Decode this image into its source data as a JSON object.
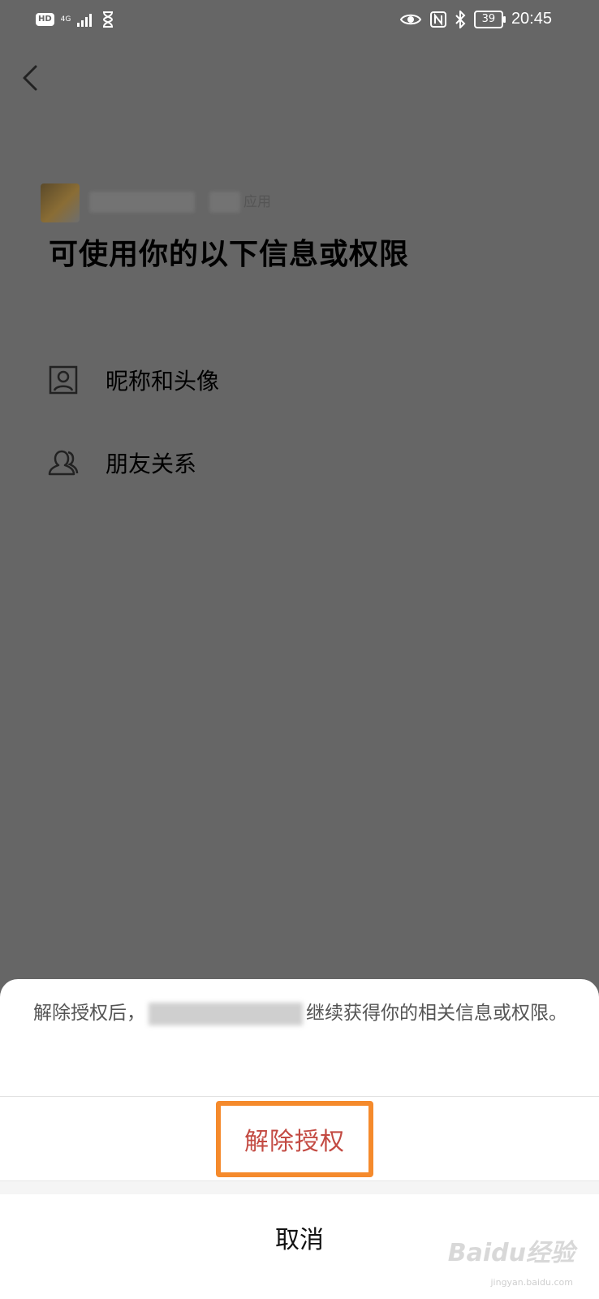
{
  "status_bar": {
    "hd": "HD",
    "network": "4G",
    "battery": "39",
    "time": "20:45"
  },
  "app": {
    "name_suffix": "应用"
  },
  "page": {
    "title": "可使用你的以下信息或权限"
  },
  "permissions": [
    {
      "label": "昵称和头像",
      "icon": "profile-card-icon"
    },
    {
      "label": "朋友关系",
      "icon": "friends-icon"
    }
  ],
  "sheet": {
    "notice_start": "解除授权后，",
    "notice_end": "继续获得你的相关信息或权限。",
    "revoke_label": "解除授权",
    "cancel_label": "取消"
  },
  "watermark": {
    "brand": "Baidu经验",
    "url": "jingyan.baidu.com"
  },
  "colors": {
    "overlay": "#666666",
    "revoke_text": "#c34a42",
    "highlight_border": "#f58a2c"
  }
}
